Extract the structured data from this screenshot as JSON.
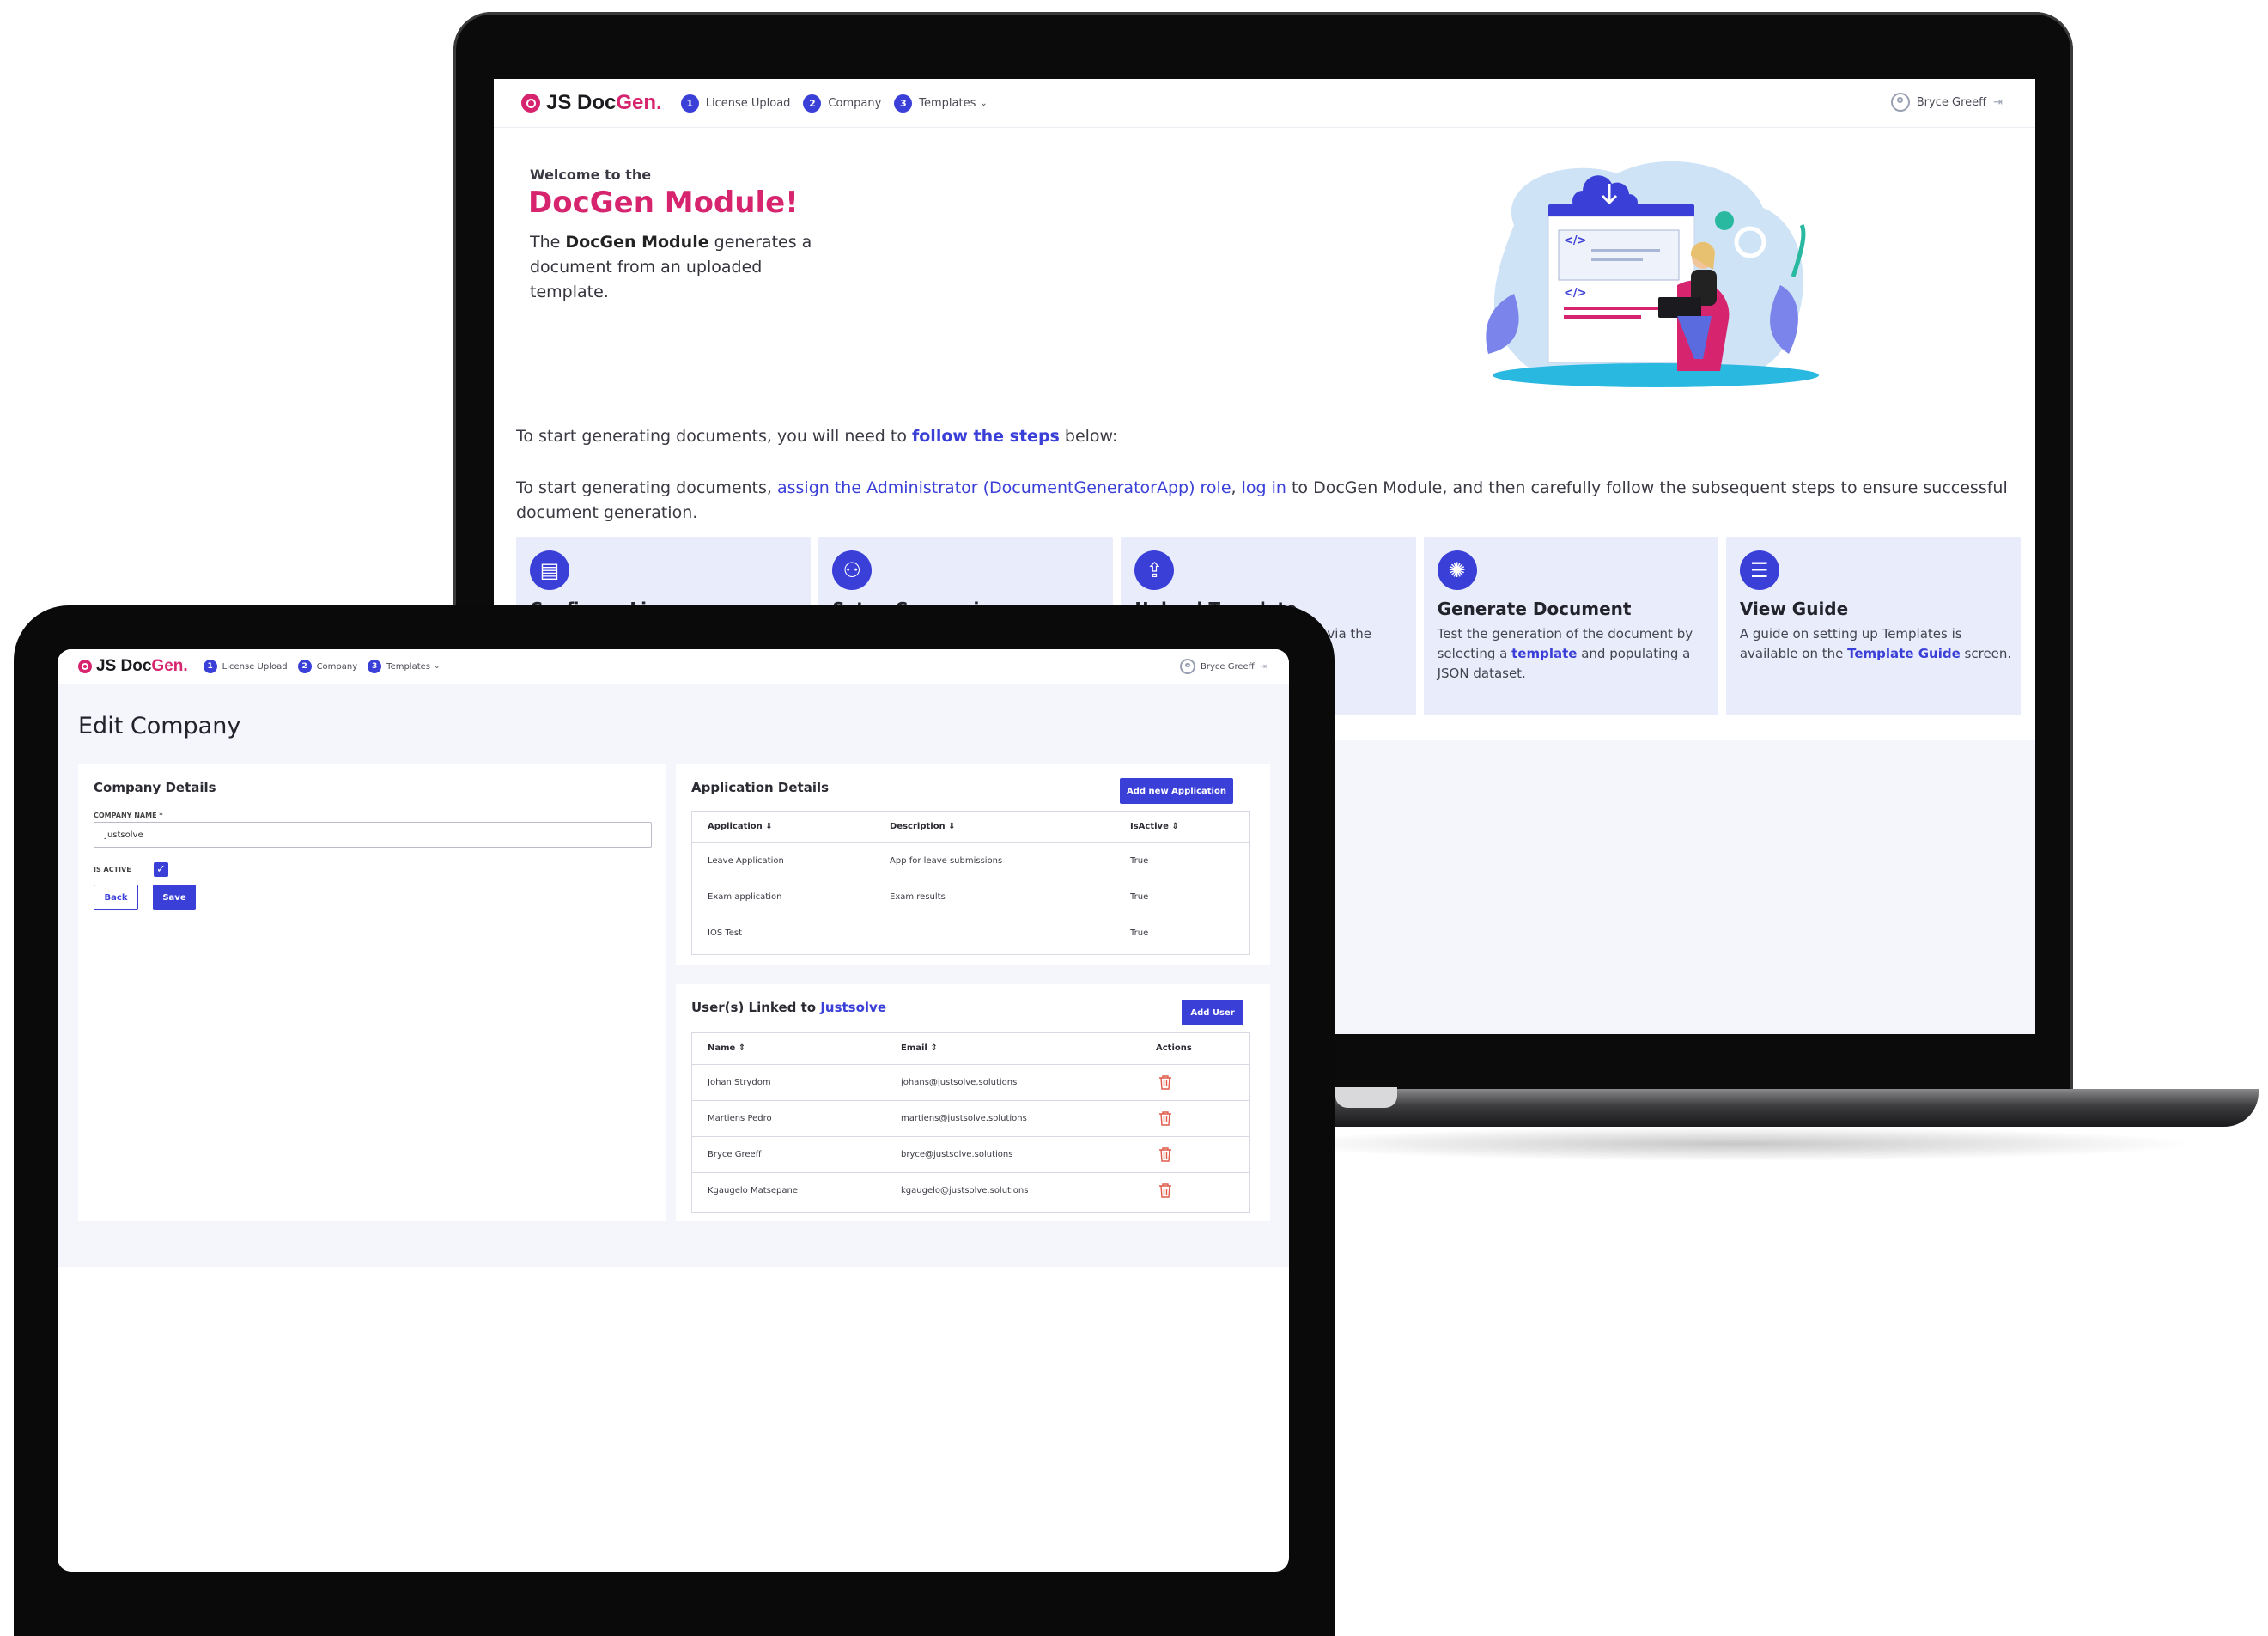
{
  "app": {
    "brand_prefix": "JS Doc",
    "brand_accent": "Gen.",
    "steps": [
      {
        "num": "1",
        "label": "License Upload"
      },
      {
        "num": "2",
        "label": "Company"
      },
      {
        "num": "3",
        "label": "Templates"
      }
    ],
    "user_name": "Bryce Greeff"
  },
  "colors": {
    "brand": "#d6246e",
    "accent": "#3a3fd8",
    "card_bg": "#e9ecfb",
    "page_bg": "#f5f6fb"
  },
  "laptop": {
    "welcome_small": "Welcome to the",
    "welcome_big": "DocGen Module!",
    "desc_pre": "The ",
    "desc_bold": "DocGen Module",
    "desc_post": " generates a document from an uploaded template.",
    "intro1_pre": "To start generating documents, you will need to ",
    "intro1_link": "follow the steps",
    "intro1_post": " below:",
    "intro2_pre": "To start generating documents, ",
    "intro2_link1": "assign the Administrator (DocumentGeneratorApp) role",
    "intro2_sep": ", ",
    "intro2_link2": "log in",
    "intro2_post": " to DocGen Module, and then carefully follow the subsequent steps to ensure successful document generation.",
    "cards": [
      {
        "icon": "document-icon",
        "title": "Configure License",
        "desc": ""
      },
      {
        "icon": "users-icon",
        "title": "Setup Companies",
        "desc": ""
      },
      {
        "icon": "upload-icon",
        "title": "Upload Template",
        "desc": "via the"
      },
      {
        "icon": "spinner-icon",
        "title": "Generate Document",
        "desc_pre": "Test the generation of the document by selecting a ",
        "desc_link": "template",
        "desc_post": " and populating a JSON dataset."
      },
      {
        "icon": "list-icon",
        "title": "View Guide",
        "desc_pre": "A guide on setting up Templates is available on the ",
        "desc_link": "Template Guide",
        "desc_post": " screen."
      }
    ]
  },
  "tablet": {
    "page_title": "Edit Company",
    "company_details": {
      "title": "Company Details",
      "company_name_label": "COMPANY NAME *",
      "company_name_value": "Justsolve",
      "is_active_label": "IS ACTIVE",
      "is_active": true,
      "back_label": "Back",
      "save_label": "Save"
    },
    "applications": {
      "title": "Application Details",
      "add_label": "Add new Application",
      "headers": [
        "Application",
        "Description",
        "IsActive"
      ],
      "rows": [
        {
          "name": "Leave Application",
          "description": "App for leave submissions",
          "active": "True"
        },
        {
          "name": "Exam application",
          "description": "Exam results",
          "active": "True"
        },
        {
          "name": "IOS Test",
          "description": "",
          "active": "True"
        }
      ]
    },
    "users": {
      "title_pre": "User(s) Linked to ",
      "title_link": "Justsolve",
      "add_label": "Add User",
      "headers": [
        "Name",
        "Email",
        "Actions"
      ],
      "rows": [
        {
          "name": "Johan Strydom",
          "email": "johans@justsolve.solutions"
        },
        {
          "name": "Martiens Pedro",
          "email": "martiens@justsolve.solutions"
        },
        {
          "name": "Bryce Greeff",
          "email": "bryce@justsolve.solutions"
        },
        {
          "name": "Kgaugelo Matsepane",
          "email": "kgaugelo@justsolve.solutions"
        }
      ]
    }
  }
}
